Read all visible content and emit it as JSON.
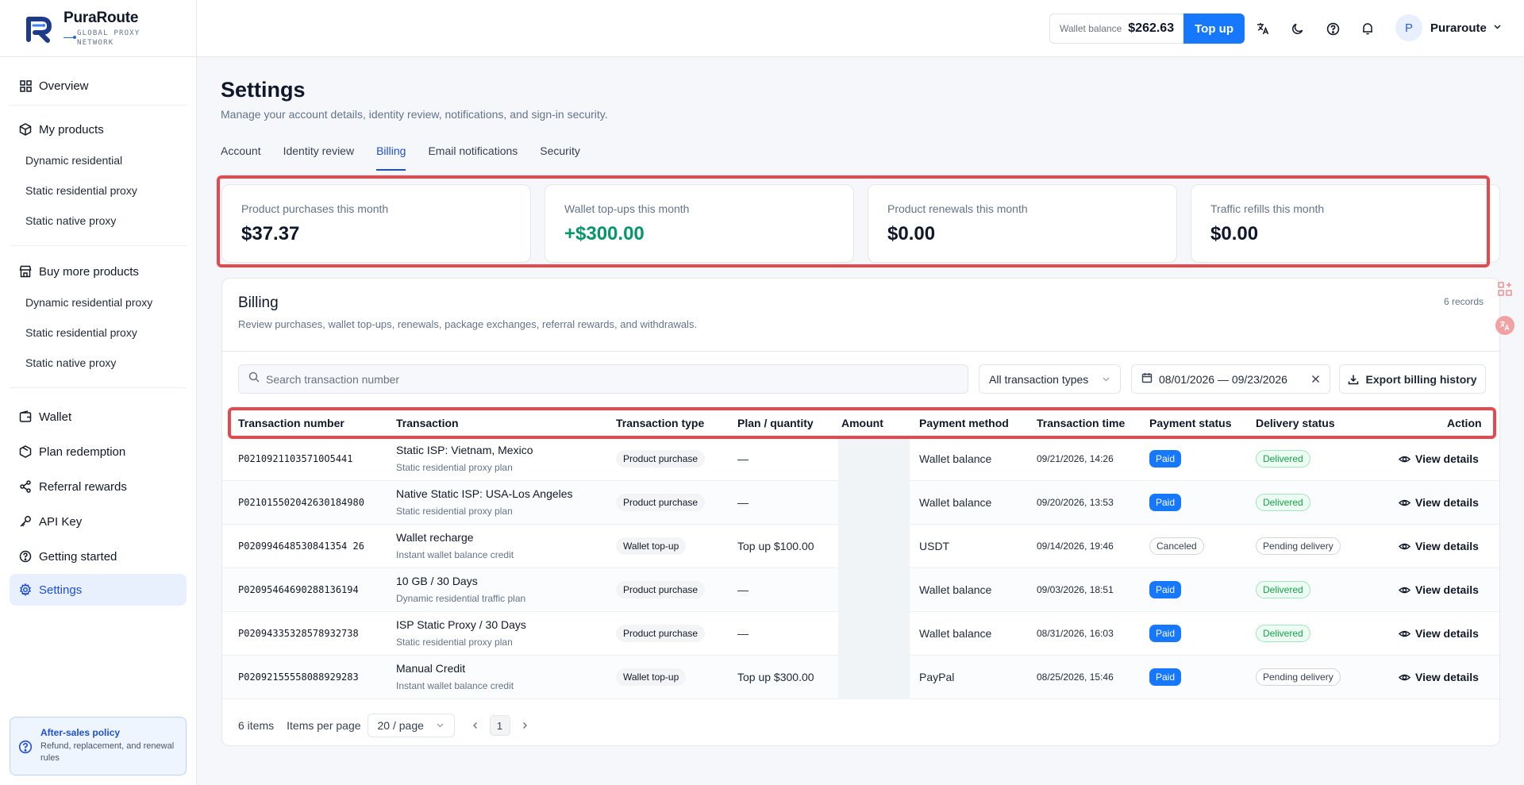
{
  "brand": {
    "name": "PuraRoute",
    "tagline": "GLOBAL PROXY NETWORK"
  },
  "sidebar": {
    "overview": "Overview",
    "my_products": {
      "label": "My products",
      "items": [
        "Dynamic residential",
        "Static residential proxy",
        "Static native proxy"
      ]
    },
    "buy_more": {
      "label": "Buy more products",
      "items": [
        "Dynamic residential proxy",
        "Static residential proxy",
        "Static native proxy"
      ]
    },
    "wallet": "Wallet",
    "plan_redemption": "Plan redemption",
    "referral_rewards": "Referral rewards",
    "api_key": "API Key",
    "getting_started": "Getting started",
    "settings": "Settings",
    "policy": {
      "title": "After-sales policy",
      "desc": "Refund, replacement, and renewal rules"
    }
  },
  "topbar": {
    "wallet_label": "Wallet balance",
    "wallet_amount": "$262.63",
    "topup_label": "Top up",
    "user_initial": "P",
    "user_name": "Puraroute"
  },
  "page": {
    "title": "Settings",
    "subtitle": "Manage your account details, identity review, notifications, and sign-in security.",
    "tabs": [
      "Account",
      "Identity review",
      "Billing",
      "Email notifications",
      "Security"
    ],
    "active_tab": "Billing"
  },
  "stats": [
    {
      "label": "Product purchases this month",
      "value": "$37.37",
      "positive": false
    },
    {
      "label": "Wallet top-ups this month",
      "value": "+$300.00",
      "positive": true
    },
    {
      "label": "Product renewals this month",
      "value": "$0.00",
      "positive": false
    },
    {
      "label": "Traffic refills this month",
      "value": "$0.00",
      "positive": false
    }
  ],
  "billing": {
    "title": "Billing",
    "subtitle": "Review purchases, wallet top-ups, renewals, package exchanges, referral rewards, and withdrawals.",
    "records": "6 records",
    "search_placeholder": "Search transaction number",
    "type_filter": "All transaction types",
    "date_range": "08/01/2026 — 09/23/2026",
    "export_label": "Export billing history",
    "columns": [
      "Transaction number",
      "Transaction",
      "Transaction type",
      "Plan / quantity",
      "Amount",
      "Payment method",
      "Transaction time",
      "Payment status",
      "Delivery status",
      "Action"
    ],
    "rows": [
      {
        "number": "P02109211035710O5441",
        "title": "Static ISP: Vietnam, Mexico",
        "sub": "Static residential proxy plan",
        "type": "Product purchase",
        "plan": "—",
        "method": "Wallet balance",
        "time": "09/21/2026, 14:26",
        "pay": "Paid",
        "delivery": "Delivered"
      },
      {
        "number": "P021015502042630184980",
        "title": "Native Static ISP: USA-Los Angeles",
        "sub": "Static residential proxy plan",
        "type": "Product purchase",
        "plan": "—",
        "method": "Wallet balance",
        "time": "09/20/2026, 13:53",
        "pay": "Paid",
        "delivery": "Delivered"
      },
      {
        "number": "P020994648530841354 26",
        "title": "Wallet recharge",
        "sub": "Instant wallet balance credit",
        "type": "Wallet top-up",
        "plan": "Top up $100.00",
        "method": "USDT",
        "time": "09/14/2026, 19:46",
        "pay": "Canceled",
        "delivery": "Pending delivery"
      },
      {
        "number": "P02095464690288136194",
        "title": "10 GB / 30 Days",
        "sub": "Dynamic residential traffic plan",
        "type": "Product purchase",
        "plan": "—",
        "method": "Wallet balance",
        "time": "09/03/2026, 18:51",
        "pay": "Paid",
        "delivery": "Delivered"
      },
      {
        "number": "P02094335328578932738",
        "title": "ISP Static Proxy / 30 Days",
        "sub": "Static residential proxy plan",
        "type": "Product purchase",
        "plan": "—",
        "method": "Wallet balance",
        "time": "08/31/2026, 16:03",
        "pay": "Paid",
        "delivery": "Delivered"
      },
      {
        "number": "P02092155558088929283",
        "title": "Manual Credit",
        "sub": "Instant wallet balance credit",
        "type": "Wallet top-up",
        "plan": "Top up $300.00",
        "method": "PayPal",
        "time": "08/25/2026, 15:46",
        "pay": "Paid",
        "delivery": "Pending delivery"
      }
    ],
    "action_label": "View details",
    "items_count": "6 items",
    "per_page_label": "Items per page",
    "per_page_value": "20 / page",
    "current_page": "1"
  }
}
